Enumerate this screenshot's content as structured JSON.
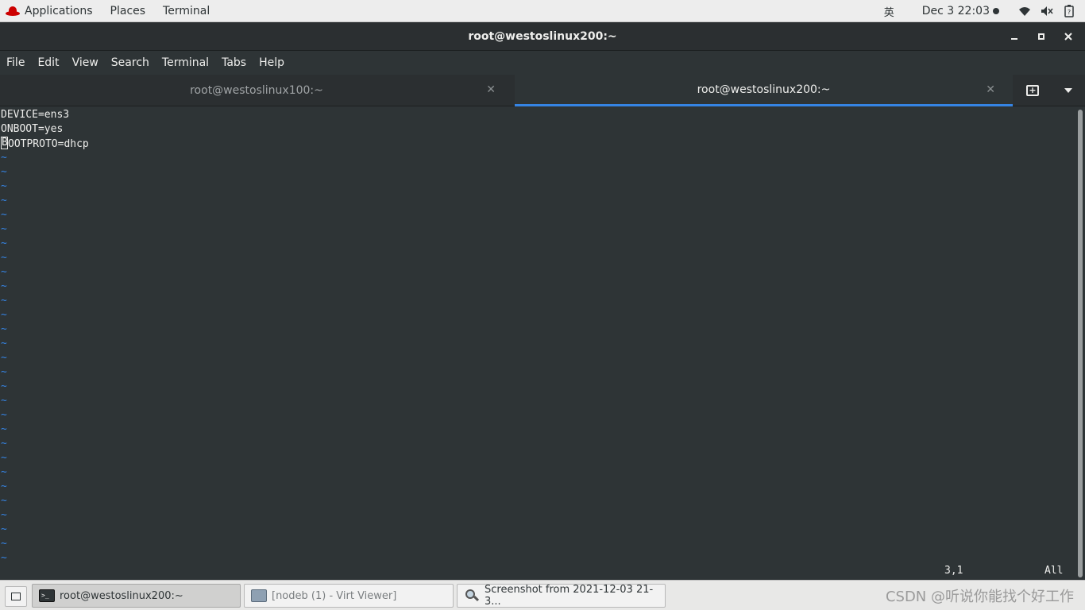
{
  "topbar": {
    "applications_label": "Applications",
    "places_label": "Places",
    "terminal_label": "Terminal",
    "input_method": "英",
    "clock": "Dec 3  22:03"
  },
  "window": {
    "title": "root@westoslinux200:~"
  },
  "menubar": {
    "items": [
      "File",
      "Edit",
      "View",
      "Search",
      "Terminal",
      "Tabs",
      "Help"
    ]
  },
  "tabs": [
    {
      "label": "root@westoslinux100:~",
      "active": false
    },
    {
      "label": "root@westoslinux200:~",
      "active": true
    }
  ],
  "terminal": {
    "lines": [
      "DEVICE=ens3",
      "ONBOOT=yes",
      "BOOTPROTO=dhcp"
    ],
    "cursor_char": "B",
    "line3_rest": "OOTPROTO=dhcp",
    "empty_line_marker": "~",
    "empty_line_count": 29,
    "status_position": "3,1",
    "status_scope": "All"
  },
  "taskbar": {
    "tasks": [
      {
        "label": "root@westoslinux200:~",
        "active": true,
        "icon": "terminal-icon"
      },
      {
        "label": "[nodeb (1) - Virt Viewer]",
        "active": false,
        "icon": "virt-viewer-icon"
      },
      {
        "label": "Screenshot from 2021-12-03 21-3...",
        "active": false,
        "icon": "screenshot-icon"
      }
    ],
    "watermark": "CSDN @听说你能找个好工作"
  },
  "colors": {
    "terminal_bg": "#2e3436",
    "terminal_fg": "#eeeeec",
    "tilde": "#3584e4",
    "active_tab_underline": "#3584e4",
    "redhat": "#cc0000"
  }
}
